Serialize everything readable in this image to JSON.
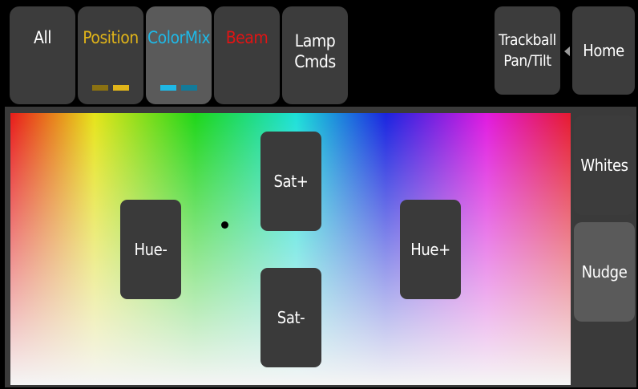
{
  "tabs": [
    {
      "label": "All",
      "color": "#ffffff",
      "swatches": []
    },
    {
      "label": "Position",
      "color": "#e0b419",
      "swatches": [
        "#8a7112",
        "#e0b419"
      ]
    },
    {
      "label": "ColorMix",
      "color": "#1fb8e6",
      "swatches": [
        "#1fb8e6",
        "#137a99"
      ]
    },
    {
      "label": "Beam",
      "color": "#e01414",
      "swatches": []
    },
    {
      "label": "Lamp\nCmds",
      "color": "#ffffff",
      "swatches": []
    }
  ],
  "selected_tab": "ColorMix",
  "top_buttons": {
    "trackball": "Trackball\nPan/Tilt",
    "home": "Home"
  },
  "side_buttons": {
    "whites": "Whites",
    "nudge": "Nudge"
  },
  "picker_buttons": {
    "hue_minus": "Hue-",
    "sat_plus": "Sat+",
    "sat_minus": "Sat-",
    "hue_plus": "Hue+"
  },
  "colors": {
    "button_bg": "#3c3c3c",
    "selected_bg": "#5a5a5a",
    "panel_bg": "#3a3a3a",
    "background": "#000000"
  }
}
